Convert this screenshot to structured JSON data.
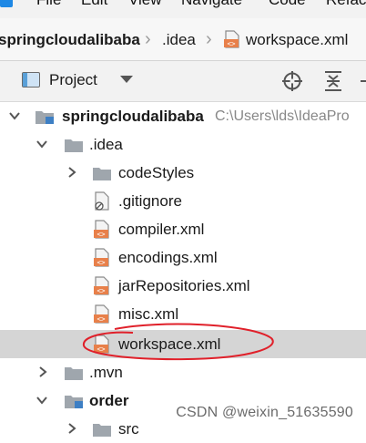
{
  "menu": {
    "items": [
      "File",
      "Edit",
      "View",
      "Navigate",
      "Code",
      "Refac"
    ]
  },
  "breadcrumb": [
    "springcloudalibaba",
    ".idea",
    "workspace.xml"
  ],
  "project_panel": {
    "title": "Project"
  },
  "tree": {
    "root": {
      "label": "springcloudalibaba",
      "path": "C:\\Users\\lds\\IdeaPro"
    },
    "idea_folder": ".idea",
    "code_styles": "codeStyles",
    "files": [
      ".gitignore",
      "compiler.xml",
      "encodings.xml",
      "jarRepositories.xml",
      "misc.xml",
      "workspace.xml"
    ],
    "mvn": ".mvn",
    "order": "order",
    "src": "src"
  },
  "watermark": "CSDN @weixin_51635590",
  "colors": {
    "selection": "#d5d5d5",
    "annotation": "#e0202a",
    "xml_badge": "#e8804a"
  }
}
